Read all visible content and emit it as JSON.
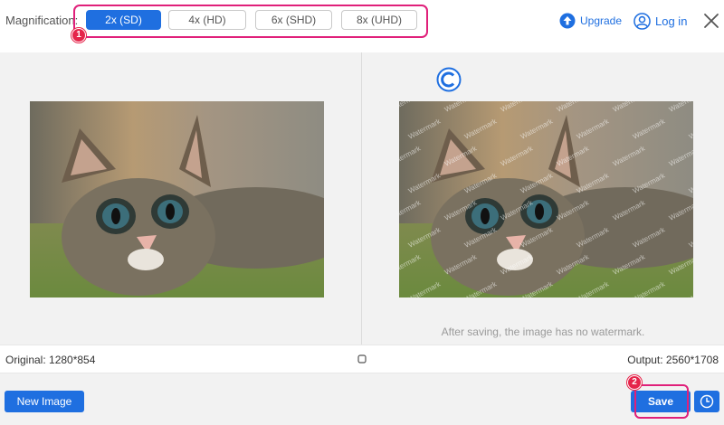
{
  "toolbar": {
    "magnification_label": "Magnification:",
    "options": [
      "2x (SD)",
      "4x (HD)",
      "6x (SHD)",
      "8x (UHD)"
    ],
    "selected": "2x (SD)",
    "step1_badge": "1",
    "upgrade_label": "Upgrade",
    "login_label": "Log in"
  },
  "preview": {
    "watermark_text": "Watermark",
    "watermark_note": "After saving, the image has no watermark."
  },
  "info": {
    "original": "Original: 1280*854",
    "output": "Output: 2560*1708"
  },
  "bottom": {
    "new_image_label": "New Image",
    "save_label": "Save",
    "step2_badge": "2"
  },
  "colors": {
    "accent": "#1f6fe0",
    "highlight": "#e0207a",
    "badge": "#e5254b"
  }
}
